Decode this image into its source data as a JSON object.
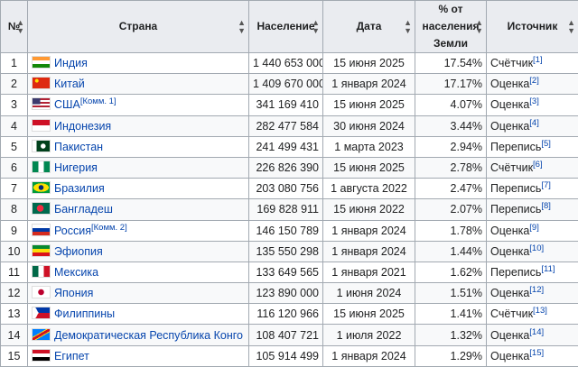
{
  "headers": {
    "num": "№",
    "country": "Страна",
    "population": "Население",
    "date": "Дата",
    "percent_l1": "% от",
    "percent_l2": "населения",
    "percent_l3": "Земли",
    "source": "Источник",
    "sort_icon": "sort-arrows-icon"
  },
  "rows": [
    {
      "n": "1",
      "country": "Индия",
      "note": "",
      "pop": "1 440 653 000",
      "date": "15 июня 2025",
      "pct": "17.54%",
      "src": "Счётчик",
      "ref": "[1]",
      "flag": "india"
    },
    {
      "n": "2",
      "country": "Китай",
      "note": "",
      "pop": "1 409 670 000",
      "date": "1 января 2024",
      "pct": "17.17%",
      "src": "Оценка",
      "ref": "[2]",
      "flag": "china"
    },
    {
      "n": "3",
      "country": "США",
      "note": "[Комм. 1]",
      "pop": "341 169 410",
      "date": "15 июня 2025",
      "pct": "4.07%",
      "src": "Оценка",
      "ref": "[3]",
      "flag": "usa"
    },
    {
      "n": "4",
      "country": "Индонезия",
      "note": "",
      "pop": "282 477 584",
      "date": "30 июня 2024",
      "pct": "3.44%",
      "src": "Оценка",
      "ref": "[4]",
      "flag": "indonesia"
    },
    {
      "n": "5",
      "country": "Пакистан",
      "note": "",
      "pop": "241 499 431",
      "date": "1 марта 2023",
      "pct": "2.94%",
      "src": "Перепись",
      "ref": "[5]",
      "flag": "pakistan"
    },
    {
      "n": "6",
      "country": "Нигерия",
      "note": "",
      "pop": "226 826 390",
      "date": "15 июня 2025",
      "pct": "2.78%",
      "src": "Счётчик",
      "ref": "[6]",
      "flag": "nigeria"
    },
    {
      "n": "7",
      "country": "Бразилия",
      "note": "",
      "pop": "203 080 756",
      "date": "1 августа 2022",
      "pct": "2.47%",
      "src": "Перепись",
      "ref": "[7]",
      "flag": "brazil"
    },
    {
      "n": "8",
      "country": "Бангладеш",
      "note": "",
      "pop": "169 828 911",
      "date": "15 июня 2022",
      "pct": "2.07%",
      "src": "Перепись",
      "ref": "[8]",
      "flag": "bangladesh"
    },
    {
      "n": "9",
      "country": "Россия",
      "note": "[Комм. 2]",
      "pop": "146 150 789",
      "date": "1 января 2024",
      "pct": "1.78%",
      "src": "Оценка",
      "ref": "[9]",
      "flag": "russia"
    },
    {
      "n": "10",
      "country": "Эфиопия",
      "note": "",
      "pop": "135 550 298",
      "date": "1 января 2024",
      "pct": "1.44%",
      "src": "Оценка",
      "ref": "[10]",
      "flag": "ethiopia"
    },
    {
      "n": "11",
      "country": "Мексика",
      "note": "",
      "pop": "133 649 565",
      "date": "1 января 2021",
      "pct": "1.62%",
      "src": "Перепись",
      "ref": "[11]",
      "flag": "mexico"
    },
    {
      "n": "12",
      "country": "Япония",
      "note": "",
      "pop": "123 890 000",
      "date": "1 июня 2024",
      "pct": "1.51%",
      "src": "Оценка",
      "ref": "[12]",
      "flag": "japan"
    },
    {
      "n": "13",
      "country": "Филиппины",
      "note": "",
      "pop": "116 120 966",
      "date": "15 июня 2025",
      "pct": "1.41%",
      "src": "Счётчик",
      "ref": "[13]",
      "flag": "philippines"
    },
    {
      "n": "14",
      "country": "Демократическая Республика Конго",
      "note": "",
      "pop": "108 407 721",
      "date": "1 июля 2022",
      "pct": "1.32%",
      "src": "Оценка",
      "ref": "[14]",
      "flag": "drc"
    },
    {
      "n": "15",
      "country": "Египет",
      "note": "",
      "pop": "105 914 499",
      "date": "1 января 2024",
      "pct": "1.29%",
      "src": "Оценка",
      "ref": "[15]",
      "flag": "egypt"
    }
  ]
}
